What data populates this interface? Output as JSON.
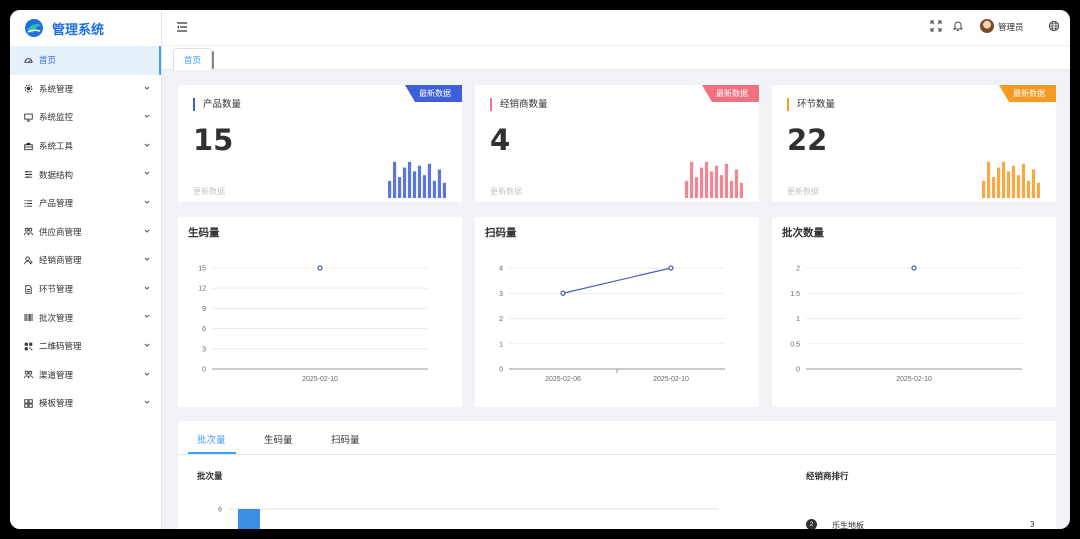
{
  "app": {
    "title": "管理系统"
  },
  "sidebar": {
    "items": [
      {
        "label": "首页",
        "icon": "dashboard-icon",
        "active": true
      },
      {
        "label": "系统管理",
        "icon": "gear-icon"
      },
      {
        "label": "系统监控",
        "icon": "monitor-icon"
      },
      {
        "label": "系统工具",
        "icon": "toolbox-icon"
      },
      {
        "label": "数据结构",
        "icon": "sliders-icon"
      },
      {
        "label": "产品管理",
        "icon": "list-icon"
      },
      {
        "label": "供应商管理",
        "icon": "users-icon"
      },
      {
        "label": "经销商管理",
        "icon": "user-icon"
      },
      {
        "label": "环节管理",
        "icon": "document-icon"
      },
      {
        "label": "批次管理",
        "icon": "barcode-icon"
      },
      {
        "label": "二维码管理",
        "icon": "qrcode-icon"
      },
      {
        "label": "渠道管理",
        "icon": "group-icon"
      },
      {
        "label": "模板管理",
        "icon": "grid-icon"
      }
    ]
  },
  "header": {
    "user": "管理员"
  },
  "tags": {
    "home": "首页"
  },
  "stats": [
    {
      "title": "产品数量",
      "value": "15",
      "foot": "更新数据",
      "ribbon": "最新数据",
      "color": "#3d5fd9",
      "bars": [
        0.45,
        0.95,
        0.55,
        0.8,
        0.95,
        0.7,
        0.85,
        0.6,
        0.9,
        0.45,
        0.75,
        0.4
      ]
    },
    {
      "title": "经销商数量",
      "value": "4",
      "foot": "更新数据",
      "ribbon": "最新数据",
      "color": "#f0707f",
      "bars": [
        0.45,
        0.95,
        0.55,
        0.8,
        0.95,
        0.7,
        0.85,
        0.6,
        0.9,
        0.45,
        0.75,
        0.4
      ]
    },
    {
      "title": "环节数量",
      "value": "22",
      "foot": "更新数据",
      "ribbon": "最新数据",
      "color": "#f59a23",
      "bars": [
        0.45,
        0.95,
        0.55,
        0.8,
        0.95,
        0.7,
        0.85,
        0.6,
        0.9,
        0.45,
        0.75,
        0.4
      ]
    }
  ],
  "chart_data": [
    {
      "type": "scatter",
      "title": "生码量",
      "x": [
        "2025-02-10"
      ],
      "values": [
        15
      ],
      "ylim": [
        0,
        15
      ],
      "yticks": [
        "0",
        "3",
        "6",
        "9",
        "12",
        "15"
      ]
    },
    {
      "type": "line",
      "title": "扫码量",
      "x": [
        "2025-02-06",
        "2025-02-10"
      ],
      "values": [
        3,
        4
      ],
      "ylim": [
        0,
        4
      ],
      "yticks": [
        "0",
        "1",
        "2",
        "3",
        "4"
      ]
    },
    {
      "type": "scatter",
      "title": "批次数量",
      "x": [
        "2025-02-10"
      ],
      "values": [
        2
      ],
      "ylim": [
        0,
        2
      ],
      "yticks": [
        "0",
        "0.5",
        "1",
        "1.5",
        "2"
      ]
    },
    {
      "type": "bar",
      "title": "批次量",
      "categories": [
        ""
      ],
      "values": [
        6
      ],
      "yticks": [
        "6"
      ]
    }
  ],
  "bottom": {
    "tabs": [
      "批次量",
      "生码量",
      "扫码量"
    ],
    "rank_title": "经销商排行",
    "ranks": [
      {
        "rank": "2",
        "name": "乐生地板",
        "value": "3"
      }
    ]
  }
}
